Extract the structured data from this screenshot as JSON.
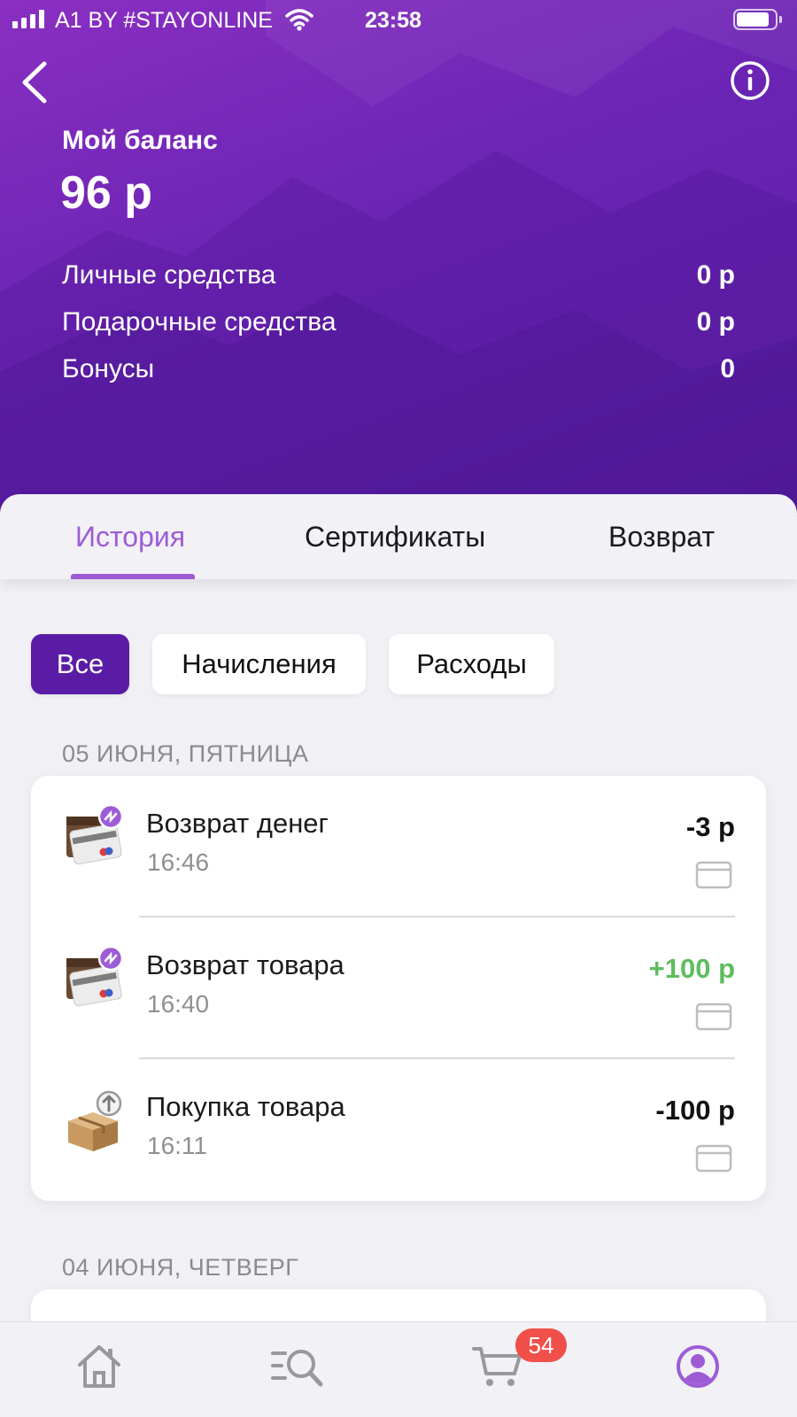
{
  "status_bar": {
    "carrier": "A1 BY #STAYONLINE",
    "time": "23:58"
  },
  "header": {
    "back_icon": "chevron-left-icon",
    "info_icon": "info-icon",
    "balance_title": "Мой баланс",
    "balance_amount": "96 р",
    "rows": [
      {
        "label": "Личные средства",
        "value": "0 р"
      },
      {
        "label": "Подарочные средства",
        "value": "0 р"
      },
      {
        "label": "Бонусы",
        "value": "0"
      }
    ]
  },
  "tabs": [
    {
      "label": "История",
      "active": true
    },
    {
      "label": "Сертификаты",
      "active": false
    },
    {
      "label": "Возврат",
      "active": false
    }
  ],
  "filters": [
    {
      "label": "Все",
      "active": true
    },
    {
      "label": "Начисления",
      "active": false
    },
    {
      "label": "Расходы",
      "active": false
    }
  ],
  "groups": [
    {
      "date": "05 ИЮНЯ, ПЯТНИЦА",
      "transactions": [
        {
          "title": "Возврат денег",
          "time": "16:46",
          "amount": "-3 р",
          "icon": "refund-card-icon"
        },
        {
          "title": "Возврат товара",
          "time": "16:40",
          "amount": "+100 р",
          "icon": "refund-card-icon"
        },
        {
          "title": "Покупка товара",
          "time": "16:11",
          "amount": "-100 р",
          "icon": "purchase-box-icon"
        }
      ]
    },
    {
      "date": "04 ИЮНЯ, ЧЕТВЕРГ",
      "transactions": []
    }
  ],
  "bottom_nav": {
    "items": [
      "home-icon",
      "catalog-search-icon",
      "cart-icon",
      "profile-icon"
    ],
    "cart_badge": "54",
    "active_color": "#9d5cd6"
  },
  "colors": {
    "accent": "#9d5cd6",
    "header_purple": "#6a24b4",
    "chip_active": "#5b1ca5",
    "positive": "#5ebd5e",
    "badge": "#f14f4a"
  }
}
